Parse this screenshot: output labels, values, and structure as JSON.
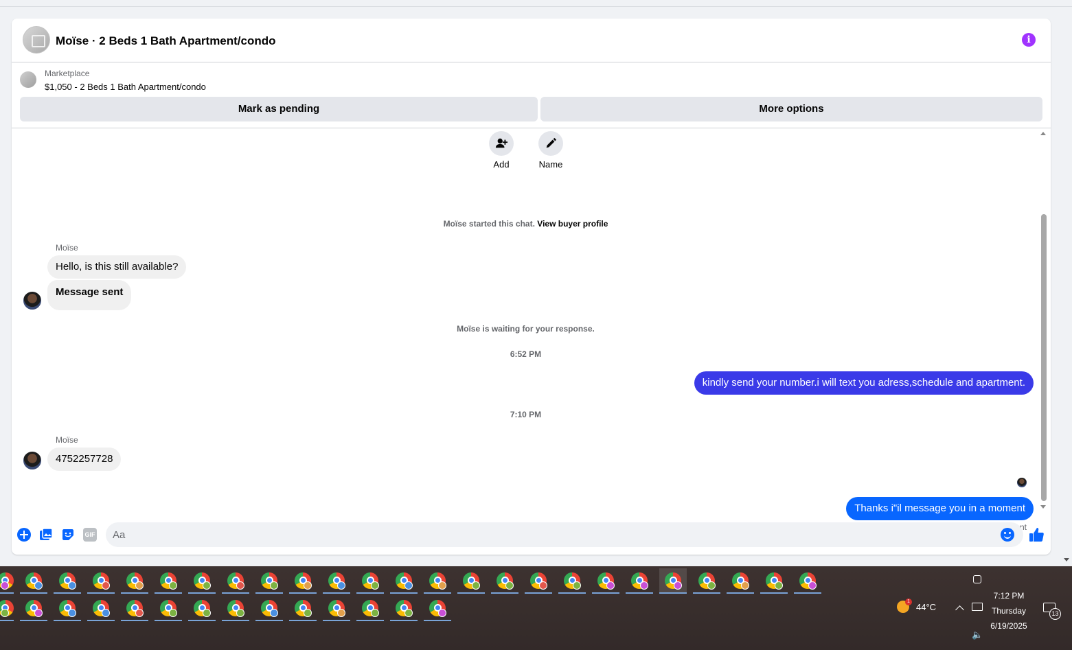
{
  "chat": {
    "title": "Moïse · 2 Beds 1 Bath Apartment/condo",
    "listing_source": "Marketplace",
    "listing_text": "$1,050 - 2 Beds 1 Bath Apartment/condo",
    "mark_pending_label": "Mark as pending",
    "more_options_label": "More options",
    "accent_color": "#0866ff",
    "info_color": "#a033ff"
  },
  "actions": {
    "add_label": "Add",
    "name_label": "Name"
  },
  "conversation": {
    "started_text": "Moïse started this chat.",
    "view_profile_link": "View buyer profile",
    "sender1": "Moïse",
    "msg1": "Hello, is this still available?",
    "msg2": "Message sent",
    "waiting_text": "Moïse is waiting for your response.",
    "time1": "6:52 PM",
    "out1": "kindly send your number.i will text you adress,schedule and apartment.",
    "out1_color": "#3a3ae8",
    "time2": "7:10 PM",
    "sender2": "Moïse",
    "msg3": "4752257728",
    "out2": "Thanks i\"il message you in a moment",
    "out2_color": "#0866ff",
    "sent_status": "Sent"
  },
  "composer": {
    "placeholder": "Aa",
    "icons": [
      "plus-icon",
      "photo-icon",
      "sticker-icon",
      "gif-icon",
      "emoji-icon",
      "thumbs-up-icon"
    ],
    "gif_label": "GIF"
  },
  "taskbar": {
    "row1_badges": [
      "#c94fd6",
      "#4a90e2",
      "#4a90e2",
      "#e2574c",
      "#e2a04c",
      "#7cb342",
      "#7cb342",
      "#e2574c",
      "#7cb342",
      "#e2a04c",
      "#4a90e2",
      "#7cb342",
      "#4a90e2",
      "#e2a04c",
      "#7cb342",
      "#7cb342",
      "#e2574c",
      "#7cb342",
      "#c94fd6",
      "#c94fd6",
      "#c94fd6",
      "#7cb342",
      "#e2a04c",
      "#7cb342",
      "#c94fd6"
    ],
    "row2_badges": [
      "#7cb342",
      "#c94fd6",
      "#4a90e2",
      "#4a90e2",
      "#e2574c",
      "#7cb342",
      "#7cb342",
      "#7cb342",
      "#4a90e2",
      "#7cb342",
      "#e2a04c",
      "#7cb342",
      "#7cb342",
      "#c94fd6"
    ],
    "active_index": 20,
    "weather_temp": "44°C",
    "weather_badge": "1",
    "clock_time": "7:12 PM",
    "clock_day": "Thursday",
    "clock_date": "6/19/2025",
    "notification_count": "13"
  }
}
